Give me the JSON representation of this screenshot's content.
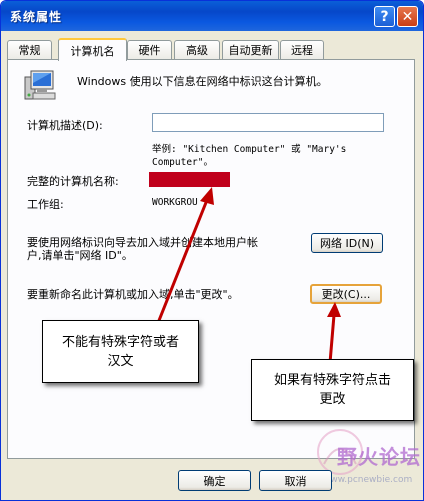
{
  "window": {
    "title": "系统属性",
    "help_button": "?",
    "close_button": "✕"
  },
  "tabs": [
    {
      "label": "常规"
    },
    {
      "label": "计算机名",
      "active": true
    },
    {
      "label": "硬件"
    },
    {
      "label": "高级"
    },
    {
      "label": "自动更新"
    },
    {
      "label": "远程"
    }
  ],
  "panel": {
    "intro": "Windows 使用以下信息在网络中标识这台计算机。",
    "description_label": "计算机描述(D):",
    "description_value": "",
    "example_line1": "举例: \"Kitchen Computer\" 或 \"Mary's",
    "example_line2": "Computer\"。",
    "full_name_label": "完整的计算机名称:",
    "workgroup_label": "工作组:",
    "workgroup_value": "WORKGROU",
    "network_text_line1": "要使用网络标识向导去加入域并创建本地用户帐",
    "network_text_line2": "户,请单击\"网络 ID\"。",
    "network_id_button": "网络 ID(N)",
    "rename_text": "要重新命名此计算机或加入域,单击\"更改\"。",
    "change_button": "更改(C)..."
  },
  "annotations": {
    "callout_left": "不能有特殊字符或者\n汉文",
    "callout_right": "如果有特殊字符点击\n更改",
    "arrow_color": "#c00000"
  },
  "footer": {
    "ok_button": "确定",
    "cancel_button": "取消"
  },
  "watermark": {
    "text": "野火论坛",
    "url": "www.pcnewbie.com"
  }
}
